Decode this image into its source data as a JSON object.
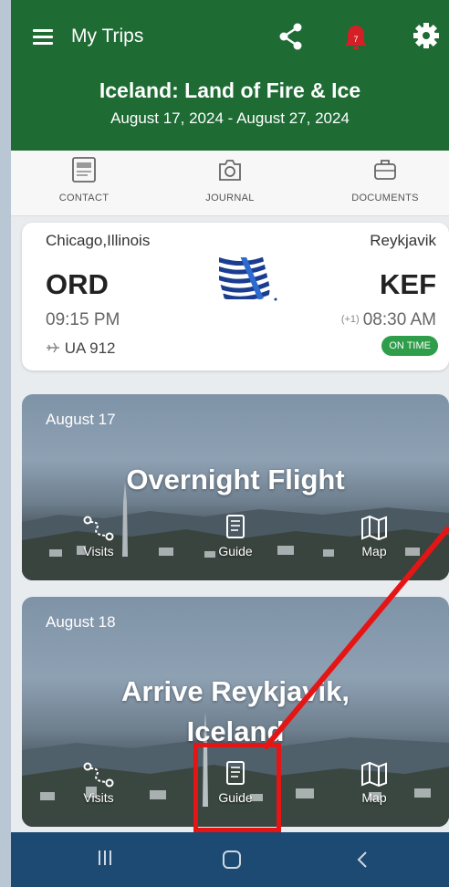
{
  "header": {
    "app_title": "My Trips",
    "notification_count": "7",
    "trip_title": "Iceland: Land of Fire & Ice",
    "trip_dates": "August 17, 2024 - August 27, 2024"
  },
  "tabs": [
    {
      "label": "CONTACT",
      "icon": "contact-card-icon"
    },
    {
      "label": "JOURNAL",
      "icon": "camera-icon"
    },
    {
      "label": "DOCUMENTS",
      "icon": "briefcase-icon"
    }
  ],
  "flight": {
    "origin_city": "Chicago,Illinois",
    "origin_code": "ORD",
    "departure_time": "09:15 PM",
    "flight_number": "UA 912",
    "destination_city": "Reykjavik",
    "destination_code": "KEF",
    "day_offset": "(+1)",
    "arrival_time": "08:30 AM",
    "status": "ON TIME",
    "airline_logo": "airline-globe-logo"
  },
  "days": [
    {
      "date": "August 17",
      "title": "Overnight Flight",
      "actions": [
        "Visits",
        "Guide",
        "Map"
      ]
    },
    {
      "date": "August 18",
      "title_line1": "Arrive Reykjavik,",
      "title_line2": "Iceland",
      "actions": [
        "Visits",
        "Guide",
        "Map"
      ]
    }
  ],
  "colors": {
    "header_green": "#1e6b34",
    "status_green": "#2f9e4a",
    "nav_blue": "#1d4a73",
    "annotation_red": "#e51515"
  }
}
